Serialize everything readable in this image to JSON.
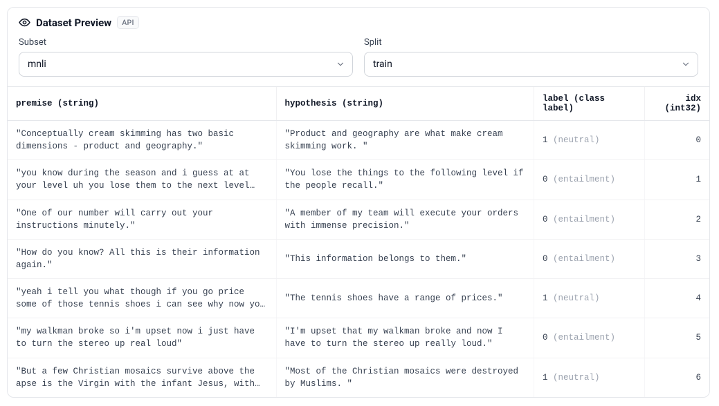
{
  "header": {
    "title": "Dataset Preview",
    "api_badge": "API"
  },
  "controls": {
    "subset_label": "Subset",
    "subset_value": "mnli",
    "split_label": "Split",
    "split_value": "train"
  },
  "columns": {
    "premise": "premise (string)",
    "hypothesis": "hypothesis (string)",
    "label": "label (class label)",
    "idx": "idx (int32)"
  },
  "rows": [
    {
      "premise": "\"Conceptually cream skimming has two basic dimensions - product and geography.\"",
      "hypothesis": "\"Product and geography are what make cream skimming work. \"",
      "label_num": "1",
      "label_name": "(neutral)",
      "idx": "0"
    },
    {
      "premise": "\"you know during the season and i guess at at your level uh you lose them to the next level if…",
      "hypothesis": "\"You lose the things to the following level if the people recall.\"",
      "label_num": "0",
      "label_name": "(entailment)",
      "idx": "1"
    },
    {
      "premise": "\"One of our number will carry out your instructions minutely.\"",
      "hypothesis": "\"A member of my team will execute your orders with immense precision.\"",
      "label_num": "0",
      "label_name": "(entailment)",
      "idx": "2"
    },
    {
      "premise": "\"How do you know? All this is their information again.\"",
      "hypothesis": "\"This information belongs to them.\"",
      "label_num": "0",
      "label_name": "(entailment)",
      "idx": "3"
    },
    {
      "premise": "\"yeah i tell you what though if you go price some of those tennis shoes i can see why now you know…",
      "hypothesis": "\"The tennis shoes have a range of prices.\"",
      "label_num": "1",
      "label_name": "(neutral)",
      "idx": "4"
    },
    {
      "premise": "\"my walkman broke so i'm upset now i just have to turn the stereo up real loud\"",
      "hypothesis": "\"I'm upset that my walkman broke and now I have to turn the stereo up really loud.\"",
      "label_num": "0",
      "label_name": "(entailment)",
      "idx": "5"
    },
    {
      "premise": "\"But a few Christian mosaics survive above the apse is the Virgin with the infant Jesus, with…",
      "hypothesis": "\"Most of the Christian mosaics were destroyed by Muslims. \"",
      "label_num": "1",
      "label_name": "(neutral)",
      "idx": "6"
    }
  ]
}
